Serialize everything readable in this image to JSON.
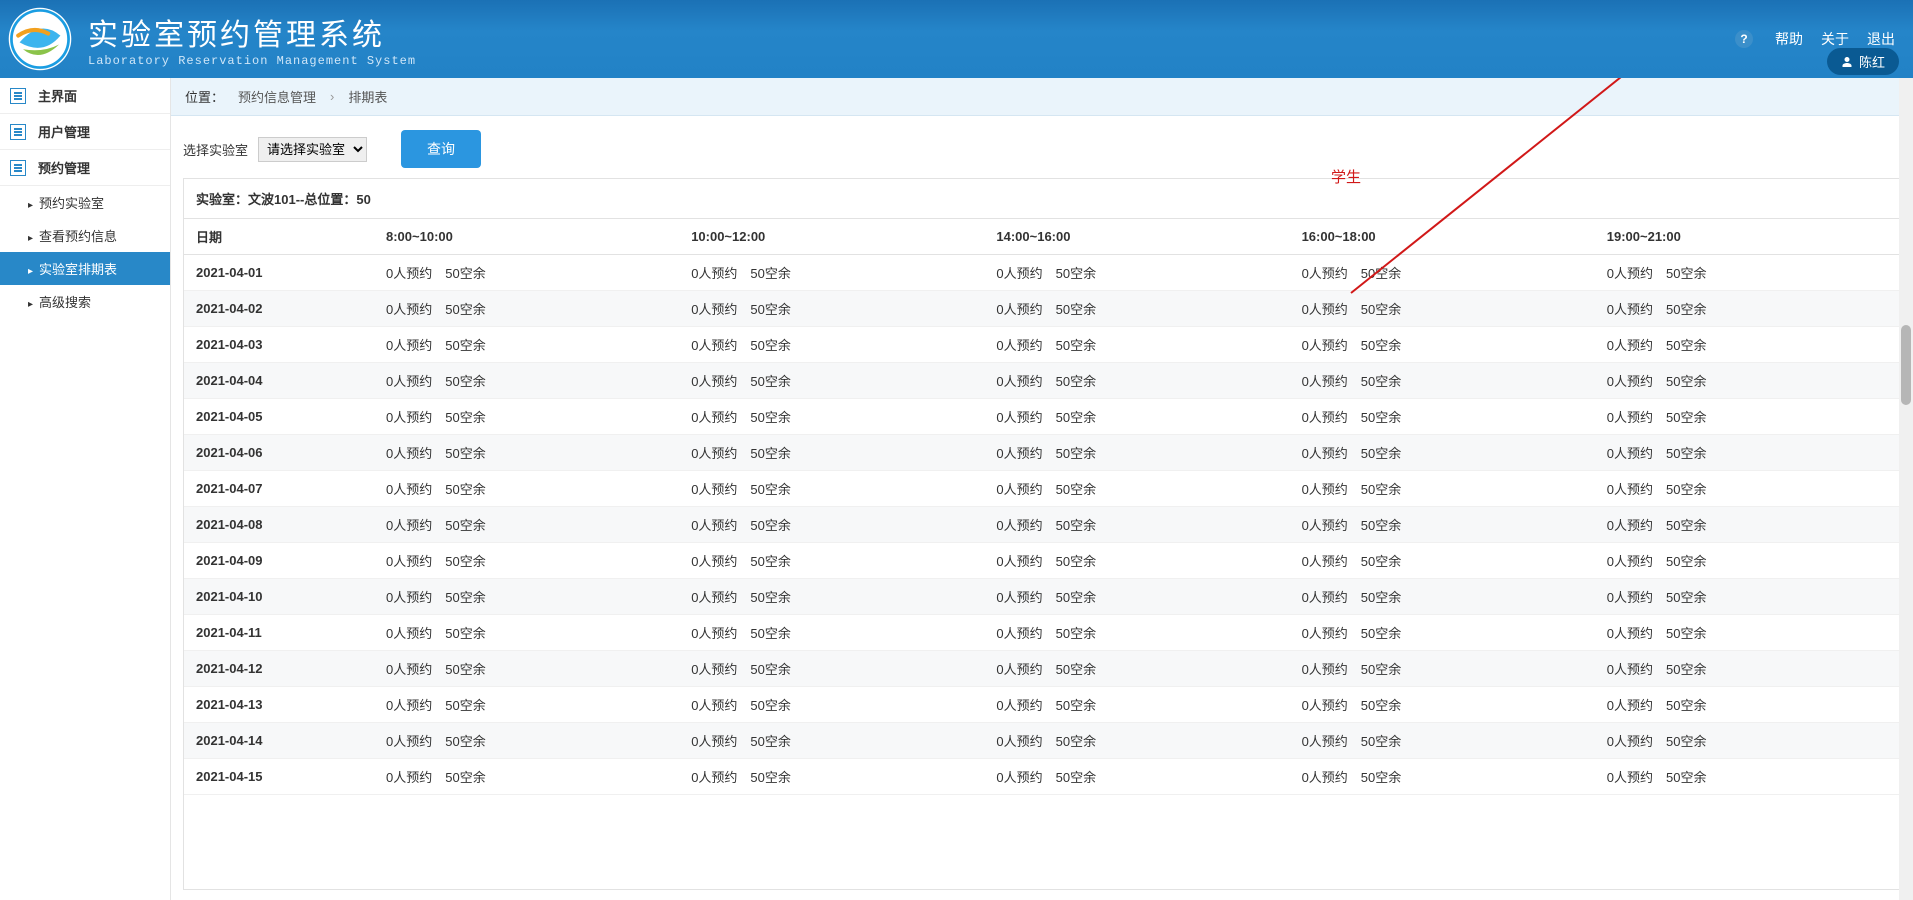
{
  "header": {
    "title": "实验室预约管理系统",
    "subtitle": "Laboratory Reservation Management System",
    "help": "帮助",
    "about": "关于",
    "logout": "退出",
    "user": "陈红"
  },
  "sidebar": {
    "main0": "主界面",
    "main1": "用户管理",
    "main2": "预约管理",
    "sub": [
      "预约实验室",
      "查看预约信息",
      "实验室排期表",
      "高级搜索"
    ],
    "activeIndex": 2
  },
  "breadcrumb": {
    "label": "位置：",
    "a": "预约信息管理",
    "b": "排期表"
  },
  "toolbar": {
    "label": "选择实验室",
    "placeholder": "请选择实验室",
    "query": "查询"
  },
  "annot": "学生",
  "lab": {
    "prefix": "实验室：文波101--总位置：",
    "seats": "50"
  },
  "columns": [
    "日期",
    "8:00~10:00",
    "10:00~12:00",
    "14:00~16:00",
    "16:00~18:00",
    "19:00~21:00"
  ],
  "rows": [
    {
      "date": "2021-04-01",
      "cells": [
        "0人预约　50空余",
        "0人预约　50空余",
        "0人预约　50空余",
        "0人预约　50空余",
        "0人预约　50空余"
      ]
    },
    {
      "date": "2021-04-02",
      "cells": [
        "0人预约　50空余",
        "0人预约　50空余",
        "0人预约　50空余",
        "0人预约　50空余",
        "0人预约　50空余"
      ]
    },
    {
      "date": "2021-04-03",
      "cells": [
        "0人预约　50空余",
        "0人预约　50空余",
        "0人预约　50空余",
        "0人预约　50空余",
        "0人预约　50空余"
      ]
    },
    {
      "date": "2021-04-04",
      "cells": [
        "0人预约　50空余",
        "0人预约　50空余",
        "0人预约　50空余",
        "0人预约　50空余",
        "0人预约　50空余"
      ]
    },
    {
      "date": "2021-04-05",
      "cells": [
        "0人预约　50空余",
        "0人预约　50空余",
        "0人预约　50空余",
        "0人预约　50空余",
        "0人预约　50空余"
      ]
    },
    {
      "date": "2021-04-06",
      "cells": [
        "0人预约　50空余",
        "0人预约　50空余",
        "0人预约　50空余",
        "0人预约　50空余",
        "0人预约　50空余"
      ]
    },
    {
      "date": "2021-04-07",
      "cells": [
        "0人预约　50空余",
        "0人预约　50空余",
        "0人预约　50空余",
        "0人预约　50空余",
        "0人预约　50空余"
      ]
    },
    {
      "date": "2021-04-08",
      "cells": [
        "0人预约　50空余",
        "0人预约　50空余",
        "0人预约　50空余",
        "0人预约　50空余",
        "0人预约　50空余"
      ]
    },
    {
      "date": "2021-04-09",
      "cells": [
        "0人预约　50空余",
        "0人预约　50空余",
        "0人预约　50空余",
        "0人预约　50空余",
        "0人预约　50空余"
      ]
    },
    {
      "date": "2021-04-10",
      "cells": [
        "0人预约　50空余",
        "0人预约　50空余",
        "0人预约　50空余",
        "0人预约　50空余",
        "0人预约　50空余"
      ]
    },
    {
      "date": "2021-04-11",
      "cells": [
        "0人预约　50空余",
        "0人预约　50空余",
        "0人预约　50空余",
        "0人预约　50空余",
        "0人预约　50空余"
      ]
    },
    {
      "date": "2021-04-12",
      "cells": [
        "0人预约　50空余",
        "0人预约　50空余",
        "0人预约　50空余",
        "0人预约　50空余",
        "0人预约　50空余"
      ]
    },
    {
      "date": "2021-04-13",
      "cells": [
        "0人预约　50空余",
        "0人预约　50空余",
        "0人预约　50空余",
        "0人预约　50空余",
        "0人预约　50空余"
      ]
    },
    {
      "date": "2021-04-14",
      "cells": [
        "0人预约　50空余",
        "0人预约　50空余",
        "0人预约　50空余",
        "0人预约　50空余",
        "0人预约　50空余"
      ]
    },
    {
      "date": "2021-04-15",
      "cells": [
        "0人预约　50空余",
        "0人预约　50空余",
        "0人预约　50空余",
        "0人预约　50空余",
        "0人预约　50空余"
      ]
    }
  ]
}
